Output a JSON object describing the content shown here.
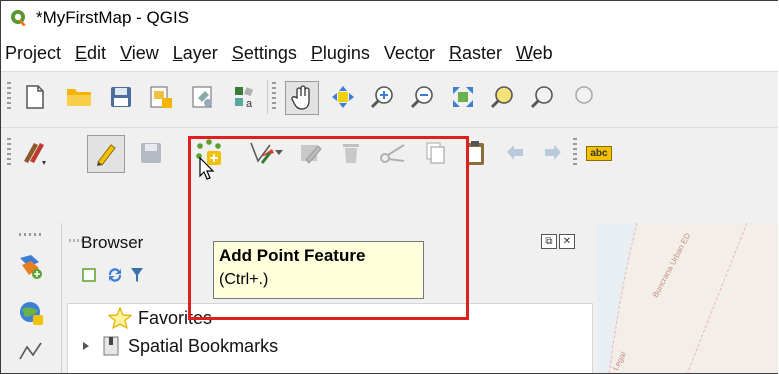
{
  "window": {
    "title": "*MyFirstMap - QGIS",
    "app_icon": "qgis-logo-icon"
  },
  "menubar": {
    "items": [
      {
        "pre": "Pro",
        "acc": "j",
        "post": "ect"
      },
      {
        "pre": "",
        "acc": "E",
        "post": "dit"
      },
      {
        "pre": "",
        "acc": "V",
        "post": "iew"
      },
      {
        "pre": "",
        "acc": "L",
        "post": "ayer"
      },
      {
        "pre": "",
        "acc": "S",
        "post": "ettings"
      },
      {
        "pre": "",
        "acc": "P",
        "post": "lugins"
      },
      {
        "pre": "Vect",
        "acc": "o",
        "post": "r"
      },
      {
        "pre": "",
        "acc": "R",
        "post": "aster"
      },
      {
        "pre": "",
        "acc": "W",
        "post": "eb"
      }
    ]
  },
  "toolbar_project": {
    "icons": [
      "new-project-icon",
      "open-project-icon",
      "save-project-icon",
      "new-print-layout-icon",
      "layout-manager-icon",
      "style-manager-icon",
      "pan-map-icon",
      "pan-to-selection-icon",
      "zoom-in-icon",
      "zoom-out-icon",
      "zoom-full-icon",
      "zoom-to-selection-icon",
      "zoom-to-layer-icon"
    ]
  },
  "toolbar_digitizing": {
    "icons": [
      "current-edits-icon",
      "toggle-editing-icon",
      "save-layer-edits-icon",
      "add-point-feature-icon",
      "vertex-tool-icon",
      "modify-attributes-icon",
      "delete-selected-icon",
      "cut-features-icon",
      "copy-features-icon",
      "paste-features-icon",
      "undo-icon",
      "redo-icon",
      "label-tool-icon"
    ],
    "label_tool_text": "abc"
  },
  "tooltip": {
    "title": "Add Point Feature",
    "shortcut": "(Ctrl+.)"
  },
  "browser": {
    "title": "Browser",
    "items": [
      {
        "label": "Favorites",
        "icon": "star-icon"
      },
      {
        "label": "Spatial Bookmarks",
        "icon": "bookmark-icon"
      }
    ]
  },
  "map": {
    "labels": [
      "Buncrana Urban ED",
      "Legal"
    ]
  },
  "colors": {
    "highlight": "#e0201f",
    "tooltip_bg": "#ffffdc",
    "qgis_green": "#589632"
  }
}
